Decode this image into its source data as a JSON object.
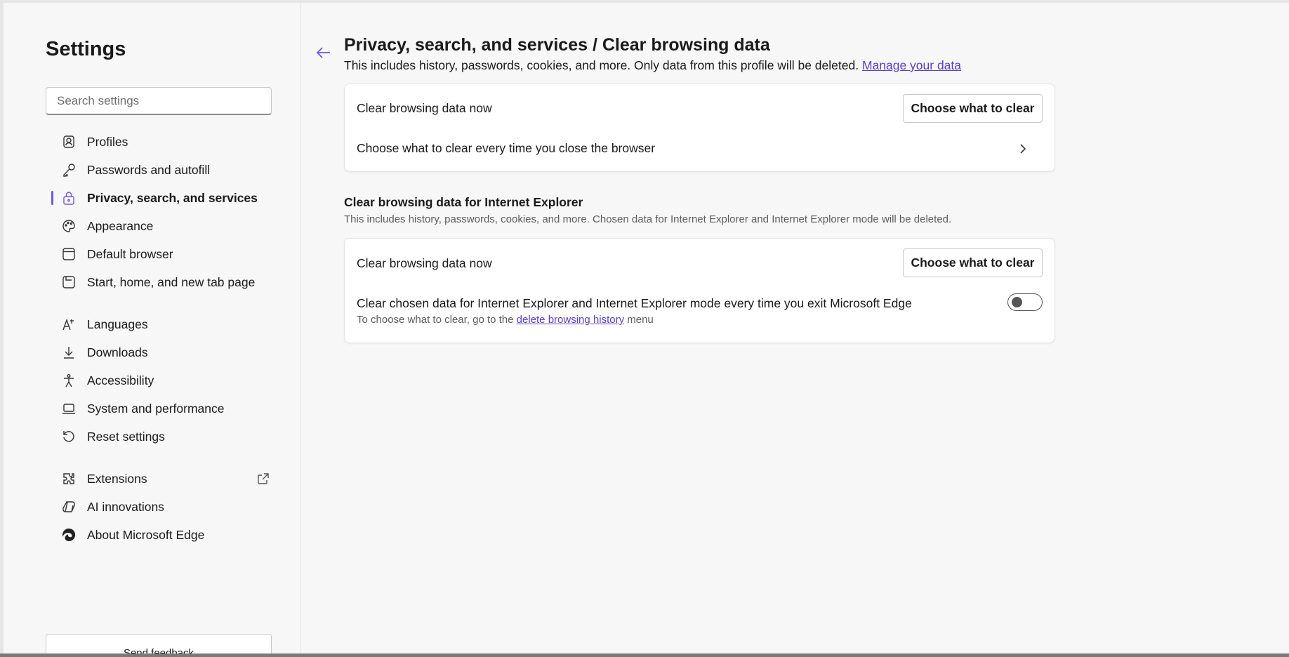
{
  "sidebar": {
    "title": "Settings",
    "search_placeholder": "Search settings",
    "group1": [
      {
        "label": "Profiles",
        "icon": "profile-icon"
      },
      {
        "label": "Passwords and autofill",
        "icon": "key-icon"
      },
      {
        "label": "Privacy, search, and services",
        "icon": "lock-icon",
        "active": true
      },
      {
        "label": "Appearance",
        "icon": "palette-icon"
      },
      {
        "label": "Default browser",
        "icon": "browser-window-icon"
      },
      {
        "label": "Start, home, and new tab page",
        "icon": "home-tab-icon"
      }
    ],
    "group2": [
      {
        "label": "Languages",
        "icon": "languages-icon"
      },
      {
        "label": "Downloads",
        "icon": "download-icon"
      },
      {
        "label": "Accessibility",
        "icon": "accessibility-icon"
      },
      {
        "label": "System and performance",
        "icon": "laptop-icon"
      },
      {
        "label": "Reset settings",
        "icon": "reset-icon"
      }
    ],
    "group3": [
      {
        "label": "Extensions",
        "icon": "extensions-icon"
      },
      {
        "label": "AI innovations",
        "icon": "ai-icon"
      },
      {
        "label": "About Microsoft Edge",
        "icon": "edge-logo-icon"
      }
    ],
    "feedback_label": "Send feedback"
  },
  "main": {
    "title": "Privacy, search, and services / Clear browsing data",
    "description": "This includes history, passwords, cookies, and more. Only data from this profile will be deleted.",
    "manage_link": "Manage your data",
    "card1": {
      "row1_label": "Clear browsing data now",
      "row1_button": "Choose what to clear",
      "row2_label": "Choose what to clear every time you close the browser"
    },
    "ie_section": {
      "heading": "Clear browsing data for Internet Explorer",
      "description": "This includes history, passwords, cookies, and more. Chosen data for Internet Explorer and Internet Explorer mode will be deleted."
    },
    "card2": {
      "row1_label": "Clear browsing data now",
      "row1_button": "Choose what to clear",
      "row2_label": "Clear chosen data for Internet Explorer and Internet Explorer mode every time you exit Microsoft Edge",
      "row2_sub_prefix": "To choose what to clear, go to the",
      "row2_sub_link": "delete browsing history",
      "row2_sub_suffix": "menu",
      "toggle_on": false
    }
  },
  "colors": {
    "accent": "#7253e5",
    "link": "#5a3fc6"
  }
}
